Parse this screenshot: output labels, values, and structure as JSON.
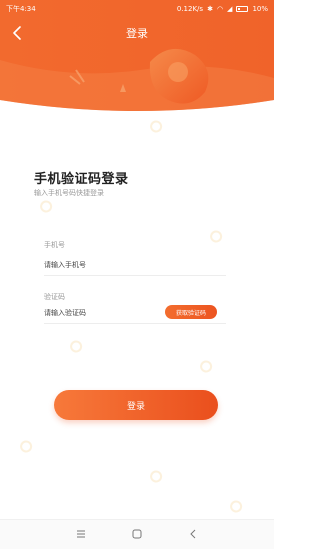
{
  "status_bar": {
    "time": "下午4:34",
    "speed": "0.12K/s",
    "battery": "10%"
  },
  "nav": {
    "title": "登录",
    "back_icon": "back-arrow-icon"
  },
  "main": {
    "title": "手机验证码登录",
    "subtitle": "输入手机号码快捷登录"
  },
  "form": {
    "phone_label": "手机号",
    "phone_placeholder": "请输入手机号",
    "code_label": "验证码",
    "code_placeholder": "请输入验证码",
    "get_code_label": "获取验证码",
    "login_label": "登录"
  },
  "colors": {
    "accent": "#f26a2e",
    "accent_dark": "#ea4f1d"
  },
  "system_nav": {
    "menu_icon": "menu-icon",
    "home_icon": "home-icon",
    "back_icon": "back-icon"
  }
}
